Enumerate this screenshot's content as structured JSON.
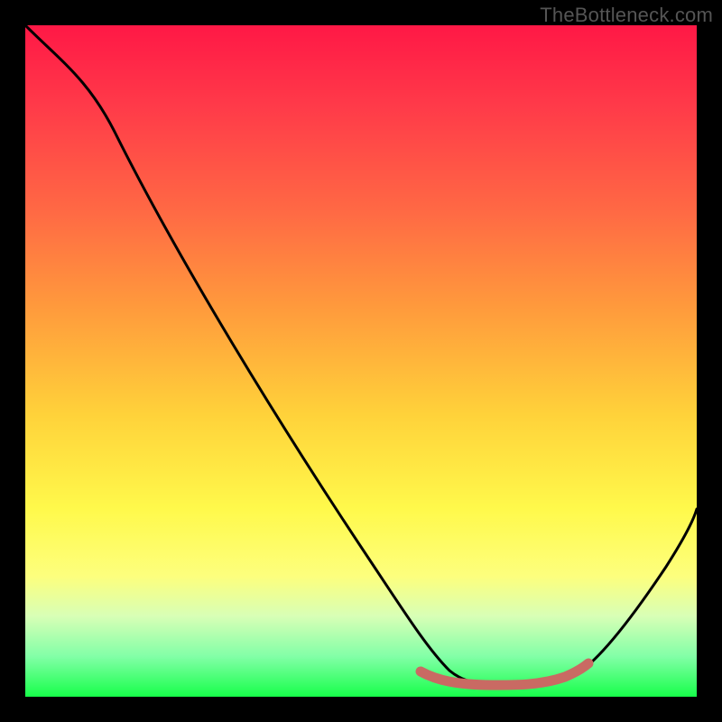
{
  "watermark": "TheBottleneck.com",
  "chart_data": {
    "type": "line",
    "title": "",
    "xlabel": "",
    "ylabel": "",
    "xlim": [
      0,
      100
    ],
    "ylim": [
      0,
      100
    ],
    "grid": false,
    "legend": false,
    "series": [
      {
        "name": "bottleneck-curve",
        "x": [
          0,
          4,
          10,
          20,
          30,
          40,
          50,
          55,
          58,
          62,
          67,
          72,
          76,
          79,
          83,
          88,
          93,
          100
        ],
        "y": [
          100,
          98,
          89,
          74,
          59,
          44,
          28,
          19,
          12,
          6,
          2.5,
          1.8,
          2,
          2.4,
          3.5,
          9,
          16,
          28
        ]
      },
      {
        "name": "highlight-flat-min",
        "x": [
          58,
          62,
          67,
          72,
          76,
          79,
          82
        ],
        "y": [
          4,
          3,
          2.6,
          2.5,
          3,
          3.4,
          4.5
        ]
      }
    ],
    "colors": {
      "curve": "#000000",
      "highlight": "#c96a63",
      "gradient_top": "#ff1846",
      "gradient_bottom": "#17ff4a"
    }
  }
}
